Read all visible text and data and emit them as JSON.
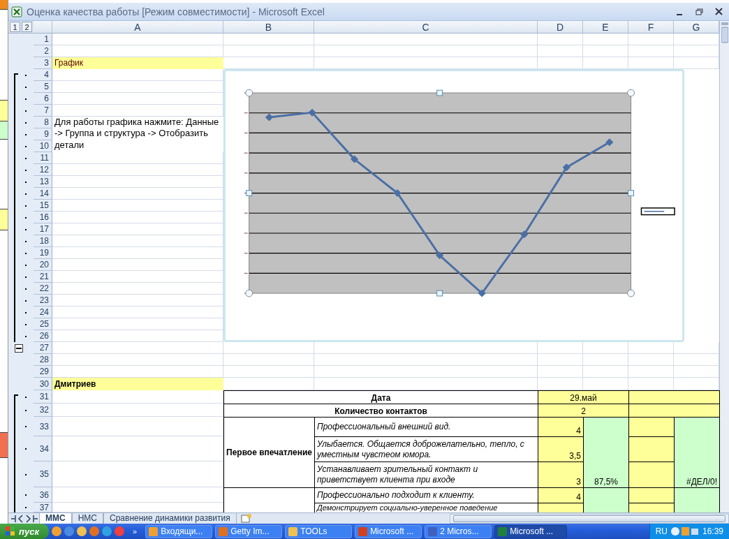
{
  "window": {
    "title": "Оценка качества работы  [Режим совместимости] - Microsoft Excel"
  },
  "outline_levels": [
    "1",
    "2"
  ],
  "columns": [
    "A",
    "B",
    "C",
    "D",
    "E",
    "F",
    "G"
  ],
  "rows": [
    {
      "number": "1",
      "grouped": false
    },
    {
      "number": "2",
      "grouped": false
    },
    {
      "number": "3",
      "grouped": false
    },
    {
      "number": "4",
      "grouped": true
    },
    {
      "number": "5",
      "grouped": true
    },
    {
      "number": "6",
      "grouped": true
    },
    {
      "number": "7",
      "grouped": true
    },
    {
      "number": "8",
      "grouped": true
    },
    {
      "number": "9",
      "grouped": true
    },
    {
      "number": "10",
      "grouped": true
    },
    {
      "number": "11",
      "grouped": true
    },
    {
      "number": "12",
      "grouped": true
    },
    {
      "number": "13",
      "grouped": true
    },
    {
      "number": "14",
      "grouped": true
    },
    {
      "number": "15",
      "grouped": true
    },
    {
      "number": "16",
      "grouped": true
    },
    {
      "number": "17",
      "grouped": true
    },
    {
      "number": "18",
      "grouped": true
    },
    {
      "number": "19",
      "grouped": true
    },
    {
      "number": "20",
      "grouped": true
    },
    {
      "number": "21",
      "grouped": true
    },
    {
      "number": "22",
      "grouped": true
    },
    {
      "number": "23",
      "grouped": true
    },
    {
      "number": "24",
      "grouped": true
    },
    {
      "number": "25",
      "grouped": true
    },
    {
      "number": "26",
      "grouped": true
    },
    {
      "number": "27",
      "grouped": false
    },
    {
      "number": "28",
      "grouped": false
    },
    {
      "number": "29",
      "grouped": false
    },
    {
      "number": "30",
      "grouped": false
    },
    {
      "number": "31",
      "grouped": true
    },
    {
      "number": "32",
      "grouped": true
    },
    {
      "number": "33",
      "grouped": true
    },
    {
      "number": "34",
      "grouped": true
    },
    {
      "number": "35",
      "grouped": true
    },
    {
      "number": "36",
      "grouped": true
    },
    {
      "number": "37",
      "grouped": true
    }
  ],
  "chart_heading": "График",
  "chart_hint": "Для работы графика нажмите: Данные -> Группа и структура -> Отобразить детали",
  "employee": "Дмитриев",
  "table": {
    "date_label": "Дата",
    "date": "29.май",
    "contacts_label": "Количество контактов",
    "contacts": "2",
    "sections": [
      {
        "title": "Первое впечатление",
        "score": "87,5%",
        "result": "#ДЕЛ/0!",
        "items": [
          {
            "text": "Профессиональный внешний вид.",
            "value": "4"
          },
          {
            "text": "Улыбается. Общается доброжелательно, тепло, с уместным чувстеом юмора.",
            "value": "3,5"
          },
          {
            "text": "Устанавливает зрительный контакт и приветствует клиента при входе",
            "value": "3"
          }
        ]
      },
      {
        "items": [
          {
            "text": "Профессионально подходит к клиенту.",
            "value": "4"
          },
          {
            "text": "Демонстрирует социально-уверенное поведение"
          }
        ]
      }
    ]
  },
  "sheet_tabs": [
    {
      "label": "ММС",
      "selected": true
    },
    {
      "label": "НМС",
      "selected": false
    },
    {
      "label": "Сравнение динамики развития",
      "selected": false
    }
  ],
  "taskbar": {
    "start": "пуск",
    "more": "»",
    "windows": [
      {
        "label": "Входящи...",
        "selected": false,
        "color": "#f0a030"
      },
      {
        "label": "Getty Im...",
        "selected": false,
        "color": "#e07020"
      },
      {
        "label": "TOOLs",
        "selected": false,
        "color": "#f0c050"
      },
      {
        "label": "Microsoft ...",
        "selected": false,
        "color": "#d04020"
      },
      {
        "label": "2 Micros...",
        "selected": false,
        "color": "#4060c0"
      },
      {
        "label": "Microsoft ...",
        "selected": true,
        "color": "#208040"
      }
    ],
    "language": "RU",
    "clock": "16:39"
  }
}
